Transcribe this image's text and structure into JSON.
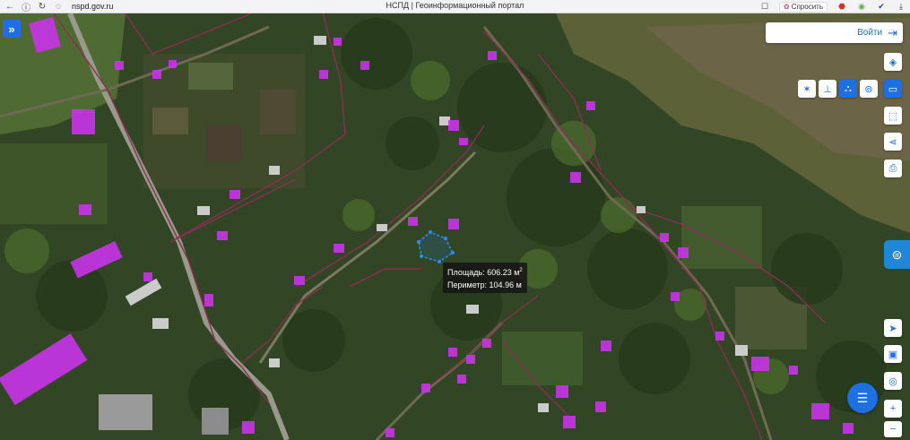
{
  "browser": {
    "url": "nspd.gov.ru",
    "page_title": "НСПД | Геоинформационный портал",
    "ask_label": "Спросить",
    "icons": [
      "back-icon",
      "info-icon",
      "reload-icon",
      "shield-icon",
      "bookmark-icon",
      "ask-icon",
      "extension-icon",
      "extension-icon-2",
      "extension-icon-3",
      "download-icon"
    ]
  },
  "header": {
    "expand_icon": "»",
    "login_label": "Войти"
  },
  "measurement": {
    "area_label": "Площадь:",
    "area_value": "606.23 м",
    "area_sup": "2",
    "perimeter_label": "Периметр:",
    "perimeter_value": "104.96 м"
  },
  "tools": {
    "layers": "layers-icon",
    "point": "point-icon",
    "line": "line-measure-icon",
    "area": "area-measure-icon",
    "circle": "circle-measure-icon",
    "ruler": "ruler-icon",
    "select": "select-icon",
    "share": "share-icon",
    "print": "print-icon",
    "navigate": "navigate-icon",
    "screen": "screen-icon",
    "gps": "gps-icon",
    "zoom_in": "+",
    "zoom_out": "−"
  },
  "colors": {
    "accent": "#1f6fe0",
    "parcel_fill": "#cc33ee",
    "boundary": "#8a2f55",
    "measure_polygon": "#2b8cff"
  }
}
